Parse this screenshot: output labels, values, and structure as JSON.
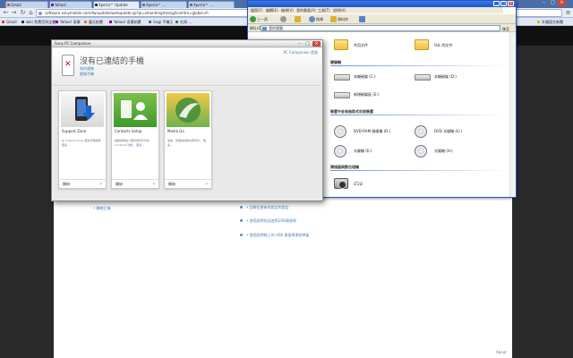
{
  "browser": {
    "tabs": [
      {
        "label": "Gmail",
        "color": "#d14836"
      },
      {
        "label": "Yahoo!",
        "color": "#7b0099"
      },
      {
        "label": "Xperia™ Update",
        "color": "#222222"
      },
      {
        "label": "Xperia™ ...",
        "color": "#6b6b6b"
      },
      {
        "label": "Xperia™ ...",
        "color": "#6b6b6b"
      }
    ],
    "url": "software.sonymobile.com/tw/update/wedupdate.zp?pl=zmonhmgmessg/lcomtm=global.ch",
    "bookmarks": [
      "Gmail",
      "wiki 免費百科全書",
      "Yahoo! 奇摩",
      "露天拍賣",
      "Yahoo! 奇摩拍賣",
      "Gogi 手機王",
      "台灣 ..."
    ],
    "bookmarks_right": "其他書籤",
    "other_bookmarks": "外國語言新聞"
  },
  "website": {
    "left_link": "• 聯絡企業",
    "items": [
      "• 回歸至更新的設定的設定",
      "• 使用說明包括使用USB連接埠",
      "• 使用說明線上的 USB 連接埠連結視窗"
    ],
    "about": "About"
  },
  "explorer": {
    "menu": [
      "檔案(F)",
      "編輯(E)",
      "檢視(V)",
      "我的最愛(A)",
      "工具(T)",
      "說明(H)"
    ],
    "toolbar": {
      "back": "上一頁",
      "search": "搜尋",
      "folders": "資料夾"
    },
    "address_label": "網址(D)",
    "address_value": "我的電腦",
    "go": "移至",
    "sections": {
      "hard_disks": "硬碟機",
      "removable": "裝置中含有抽取式存放裝置",
      "scanners": "掃描器與數位相機"
    },
    "items": {
      "shared_docs": "共用文件",
      "my_docs": "faiL 的文件",
      "disk_c": "本機磁碟 (C:)",
      "disk_d": "本機磁碟 (D:)",
      "disk_e": "新增磁碟區 (E:)",
      "dvd_ram": "DVD-RAM 磁碟機 (D:)",
      "dvd": "DVD 光碟機 (G:)",
      "cd_e": "光碟機 (E:)",
      "cd_h": "光碟機 (H:)",
      "camera": "LT22i"
    }
  },
  "pcc": {
    "title": "Sony PC Companion",
    "heading": "沒有已連結的手機",
    "link_connect": "如何連線",
    "link_change": "更換手機",
    "brand": "PC Companion 首頁",
    "cards": [
      {
        "title": "Support Zone",
        "desc": "在 Support Zone 更新手機軟體、",
        "more": "更多...",
        "start": "開始"
      },
      {
        "title": "Contacts Setup",
        "desc": "啟動將聯絡人備份或同步化的 Contacts 功能，",
        "more": "更多...",
        "start": "開始"
      },
      {
        "title": "Media Go",
        "desc": "播放、整理與媒體內容同步。",
        "more": "更多...",
        "start": "開始"
      }
    ]
  }
}
